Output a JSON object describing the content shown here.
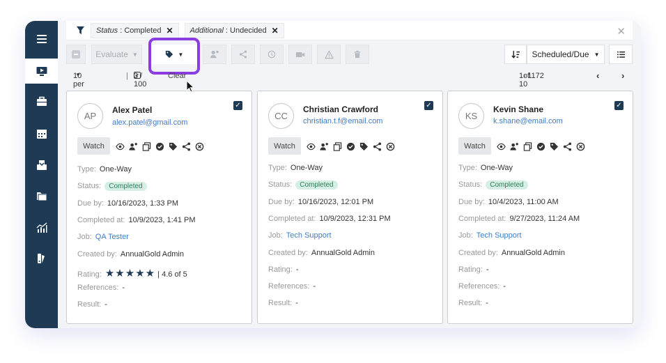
{
  "filters": [
    {
      "key": "Status",
      "value": "Completed"
    },
    {
      "key": "Additional",
      "value": "Undecided"
    }
  ],
  "toolbar": {
    "evaluate_label": "Evaluate",
    "sort_label": "Scheduled/Due"
  },
  "pager": {
    "per_page": "10 per page",
    "selected": "3 / 100",
    "clear": "Clear",
    "range": "1-10",
    "of": "of",
    "total": "1172"
  },
  "labels": {
    "watch": "Watch",
    "type": "Type:",
    "status": "Status:",
    "due_by": "Due by:",
    "completed_at": "Completed at:",
    "job": "Job:",
    "created_by": "Created by:",
    "rating": "Rating:",
    "references": "References:",
    "result": "Result:"
  },
  "cards": [
    {
      "initials": "AP",
      "name": "Alex Patel",
      "email": "alex.patel@gmail.com",
      "type": "One-Way",
      "status": "Completed",
      "due_by": "10/16/2023, 1:33 PM",
      "completed_at": "10/9/2023, 1:41 PM",
      "job": "QA Tester",
      "created_by": "AnnualGold Admin",
      "rating_stars": "★★★★★",
      "rating_text": "4.6 of 5",
      "rating": 4.6,
      "references": "-",
      "result": "-"
    },
    {
      "initials": "CC",
      "name": "Christian Crawford",
      "email": "christian.t.f@email.com",
      "type": "One-Way",
      "status": "Completed",
      "due_by": "10/16/2023, 12:01 PM",
      "completed_at": "10/9/2023, 12:31 PM",
      "job": "Tech Support",
      "created_by": "AnnualGold Admin",
      "rating_text": "-",
      "references": "-",
      "result": "-"
    },
    {
      "initials": "KS",
      "name": "Kevin Shane",
      "email": "k.shane@email.com",
      "type": "One-Way",
      "status": "Completed",
      "due_by": "10/4/2023, 11:00 AM",
      "completed_at": "9/27/2023, 11:24 AM",
      "job": "Tech Support",
      "created_by": "AnnualGold Admin",
      "rating_text": "-",
      "references": "-",
      "result": "-"
    }
  ],
  "colors": {
    "sidebar": "#1e3a54",
    "accent_link": "#3d7cc9",
    "highlight": "#8b3ee0",
    "badge_bg": "#d6efe4"
  }
}
